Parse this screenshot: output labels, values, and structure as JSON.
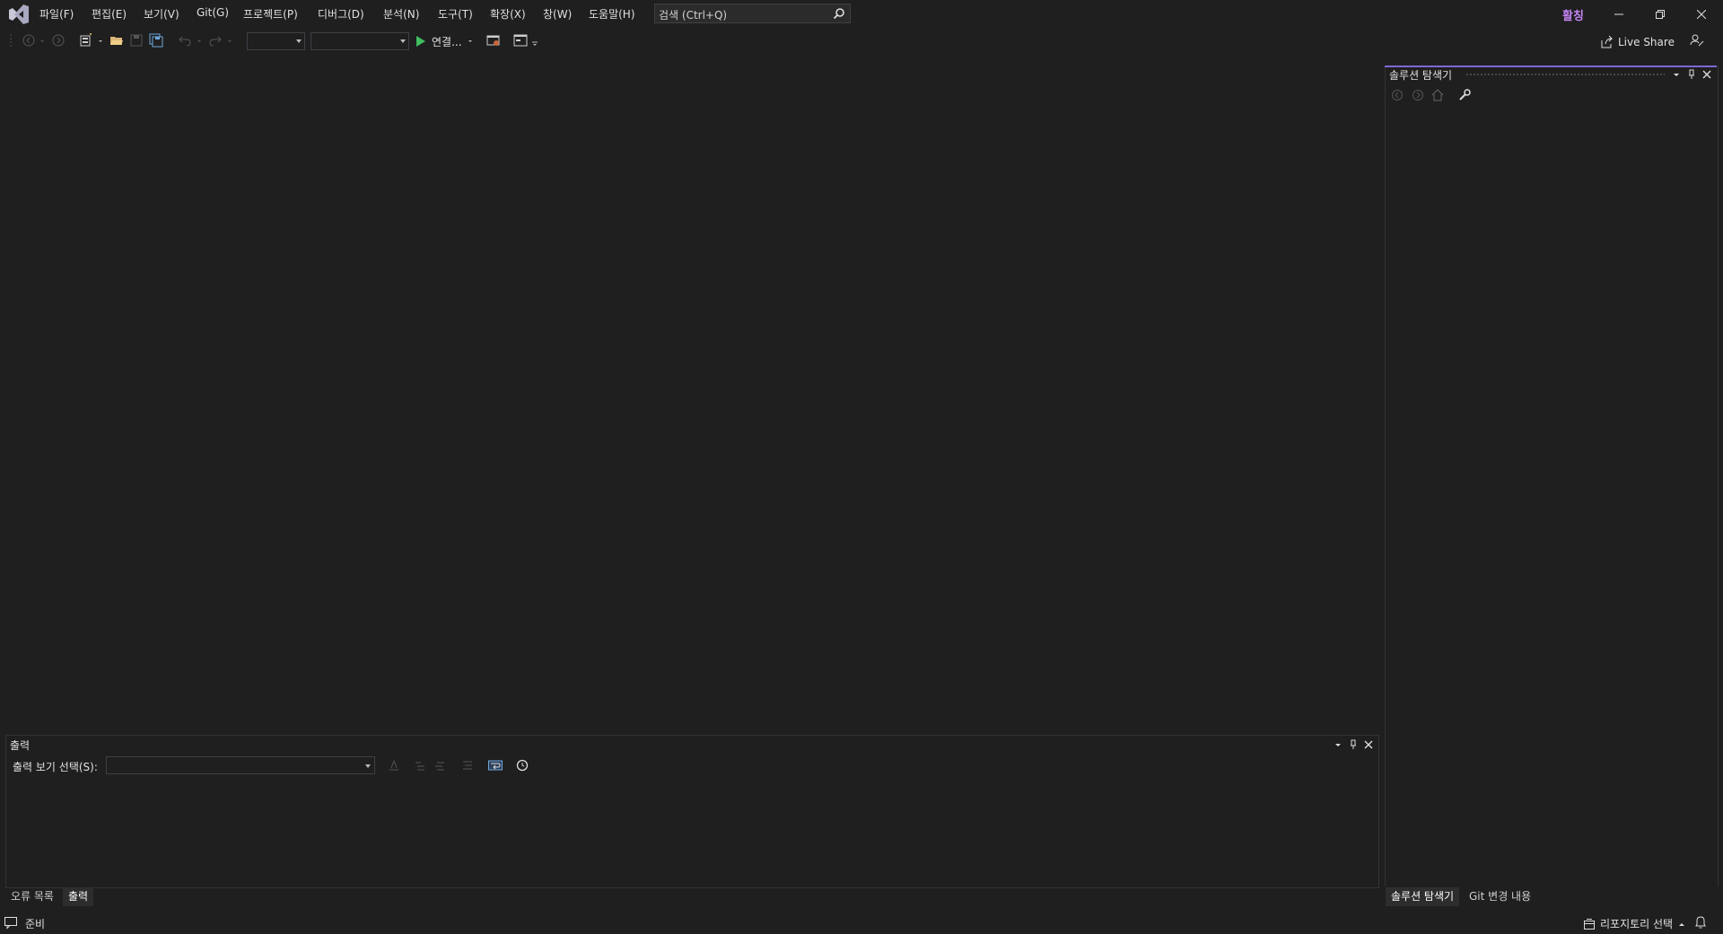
{
  "app": {
    "logo_icon": "visual-studio-logo-icon",
    "accent": "#7f66d6"
  },
  "menu": {
    "items": [
      "파일(F)",
      "편집(E)",
      "보기(V)",
      "Git(G)",
      "프로젝트(P)",
      "디버그(D)",
      "분석(N)",
      "도구(T)",
      "확장(X)",
      "창(W)",
      "도움말(H)"
    ]
  },
  "search": {
    "placeholder": "검색 (Ctrl+Q)"
  },
  "title_badge": "활칭",
  "toolbar": {
    "run_label": "연결...",
    "live_share": "Live Share"
  },
  "solution_explorer": {
    "title": "솔루션 탐색기",
    "tabs": [
      "솔루션 탐색기",
      "Git 변경 내용"
    ]
  },
  "output": {
    "title": "출력",
    "select_label": "출력 보기 선택(S):",
    "tabs": [
      "오류 목록",
      "출력"
    ]
  },
  "status": {
    "text": "준비",
    "repo_select": "리포지토리 선택"
  }
}
